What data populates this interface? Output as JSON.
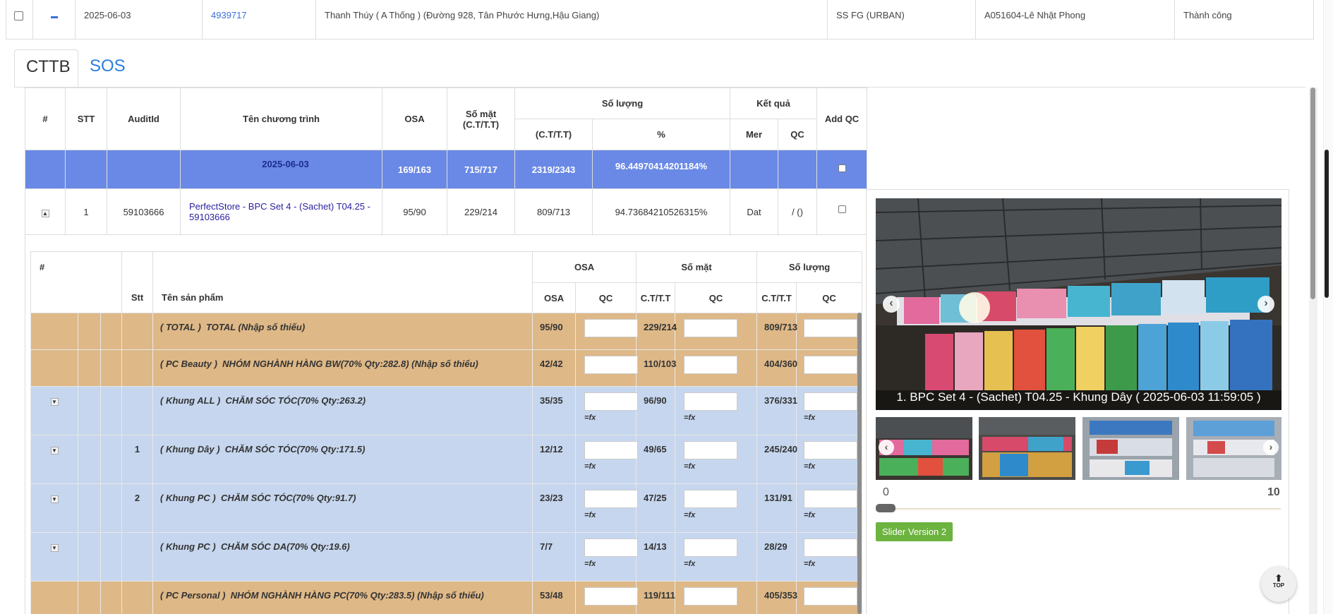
{
  "top_row": {
    "date": "2025-06-03",
    "id_link": "4939717",
    "store": "Thanh Thúy ( A Thống ) (Đường 928, Tân Phước Hưng,Hậu Giang)",
    "channel": "SS FG (URBAN)",
    "staff": "A051604-Lê Nhật Phong",
    "status": "Thành công"
  },
  "tabs": [
    "CTTB",
    "SOS"
  ],
  "main_table": {
    "headers": {
      "hash": "#",
      "stt": "STT",
      "audit": "AuditId",
      "program": "Tên chương trình",
      "osa": "OSA",
      "somat": "Số mặt",
      "somat_sub": "(C.T/T.T)",
      "soluong": "Số lượng",
      "soluong_sub1": "(C.T/T.T)",
      "soluong_sub2": "%",
      "ketqua": "Kết quả",
      "mer": "Mer",
      "qc": "QC",
      "addqc": "Add QC"
    },
    "summary": {
      "date": "2025-06-03",
      "osa": "169/163",
      "somat": "715/717",
      "soluong": "2319/2343",
      "percent": "96.44970414201184%"
    },
    "row": {
      "stt": "1",
      "audit": "59103666",
      "program": "PerfectStore - BPC Set 4 - (Sachet) T04.25 - 59103666",
      "osa": "95/90",
      "somat": "229/214",
      "soluong": "809/713",
      "percent": "94.73684210526315%",
      "mer": "Dat",
      "qc": "/ ()"
    }
  },
  "sub_table": {
    "headers": {
      "hash": "#",
      "stt": "Stt",
      "name": "Tên sản phẩm",
      "osa": "OSA",
      "somat": "Số mặt",
      "soluong": "Số lượng",
      "osa_sub": "OSA",
      "qc": "QC",
      "ctt": "C.T/T.T"
    },
    "fx": "=fx",
    "rows": [
      {
        "type": "orange",
        "stt": "",
        "code": "( TOTAL )",
        "name": "TOTAL (Nhập số thiếu)",
        "osa": "95/90",
        "somat": "229/214",
        "soluong": "809/713",
        "fx": false,
        "exp": false
      },
      {
        "type": "orange",
        "stt": "",
        "code": "( PC Beauty )",
        "name": "NHÓM NGHÀNH HÀNG BW(70% Qty:282.8) (Nhập số thiếu)",
        "osa": "42/42",
        "somat": "110/103",
        "soluong": "404/360",
        "fx": false,
        "exp": false
      },
      {
        "type": "blue",
        "stt": "",
        "code": "( Khung ALL )",
        "name": "CHĂM SÓC TÓC(70% Qty:263.2)",
        "osa": "35/35",
        "somat": "96/90",
        "soluong": "376/331",
        "fx": true,
        "exp": true,
        "blue": false
      },
      {
        "type": "blue",
        "stt": "1",
        "code": "( Khung Dây )",
        "name": "CHĂM SÓC TÓC(70% Qty:171.5)",
        "osa": "12/12",
        "somat": "49/65",
        "soluong": "245/240",
        "fx": true,
        "exp": true,
        "blue": true
      },
      {
        "type": "blue",
        "stt": "2",
        "code": "( Khung PC )",
        "name": "CHĂM SÓC TÓC(70% Qty:91.7)",
        "osa": "23/23",
        "somat": "47/25",
        "soluong": "131/91",
        "fx": true,
        "exp": true,
        "blue": false
      },
      {
        "type": "blue",
        "stt": "",
        "code": "( Khung PC )",
        "name": "CHĂM SÓC DA(70% Qty:19.6)",
        "osa": "7/7",
        "somat": "14/13",
        "soluong": "28/29",
        "fx": true,
        "exp": true,
        "blue": false
      },
      {
        "type": "orange",
        "stt": "",
        "code": "( PC Personal )",
        "name": "NHÓM NGHÀNH HÀNG PC(70% Qty:283.5) (Nhập số thiếu)",
        "osa": "53/48",
        "somat": "119/111",
        "soluong": "405/353",
        "fx": false,
        "exp": false
      }
    ]
  },
  "slider": {
    "caption": "1. BPC Set 4 - (Sachet) T04.25 - Khung Dây ( 2025-06-03 11:59:05 )",
    "min": "0",
    "max": "10",
    "button": "Slider Version 2"
  },
  "top_button": "TOP",
  "colors": {
    "accent": "#6a89e6",
    "orange_row": "#deb887",
    "blue_row": "#c6d6ee",
    "category_red": "#d8132f",
    "category_blue": "#2222c0",
    "slider_btn": "#6cb33f"
  }
}
